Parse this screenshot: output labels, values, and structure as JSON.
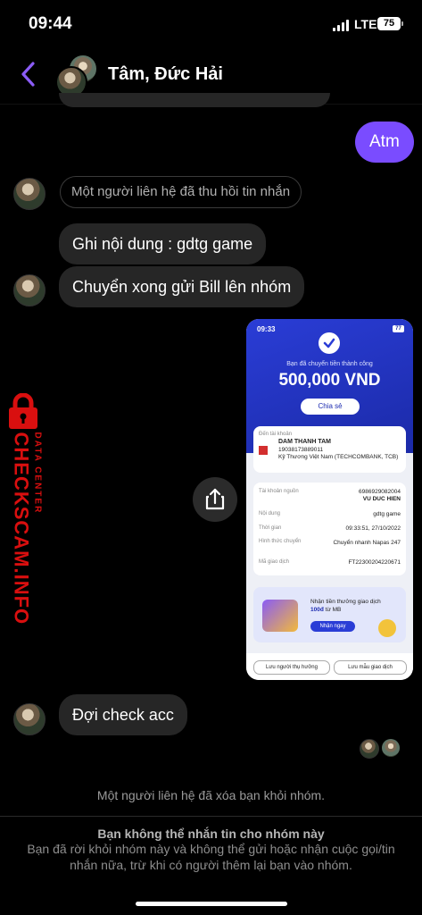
{
  "status_bar": {
    "time": "09:44",
    "network": "LTE",
    "battery": "75"
  },
  "header": {
    "title": "Tâm, Đức Hải"
  },
  "messages": {
    "outgoing_1": "Atm",
    "recall_notice": "Một người liên hệ đã thu hồi tin nhắn",
    "incoming_1": "Ghi nội dung : gdtg game",
    "incoming_2": "Chuyển xong gửi Bill lên nhóm",
    "incoming_3": "Đợi check acc"
  },
  "watermark": {
    "brand": "CHECKSCAM.INFO",
    "sub": "DATA CENTER"
  },
  "receipt": {
    "time": "09:33",
    "battery": "77",
    "success_text": "Bạn đã chuyển tiền thành công",
    "amount": "500,000 VND",
    "share_label": "Chia sẻ",
    "to_account_label": "Đến tài khoản",
    "recipient_name": "DAM THANH TAM",
    "recipient_account": "19038173889011",
    "bank": "Kỹ Thương Việt Nam (TECHCOMBANK, TCB)",
    "source_label": "Tài khoản nguồn",
    "source_account": "6986929082004",
    "source_name": "VU DUC HIEN",
    "content_label": "Nội dung",
    "content_value": "gdtg game",
    "time_label": "Thời gian",
    "time_value": "09:33:51, 27/10/2022",
    "method_label": "Hình thức chuyển",
    "method_value": "Chuyển nhanh Napas 247",
    "txn_label": "Mã giao dịch",
    "txn_value": "FT22300204220671",
    "promo_text": "Nhận tiền thưởng giao dịch",
    "promo_amount": "100đ",
    "promo_suffix": "từ MB",
    "promo_button": "Nhận ngay",
    "save_recipient": "Lưu người thụ hưởng",
    "save_template": "Lưu mẫu giao dịch"
  },
  "system": {
    "removed_notice": "Một người liên hệ đã xóa bạn khỏi nhóm.",
    "cannot_message_title": "Bạn không thể nhắn tin cho nhóm này",
    "cannot_message_body": "Bạn đã rời khỏi nhóm này và không thể gửi hoặc nhận cuộc gọi/tin nhắn nữa, trừ khi có người thêm lại bạn vào nhóm."
  },
  "colors": {
    "outgoing_bubble": "#7a4cff",
    "incoming_bubble": "#262626",
    "watermark": "#d90f0f"
  }
}
